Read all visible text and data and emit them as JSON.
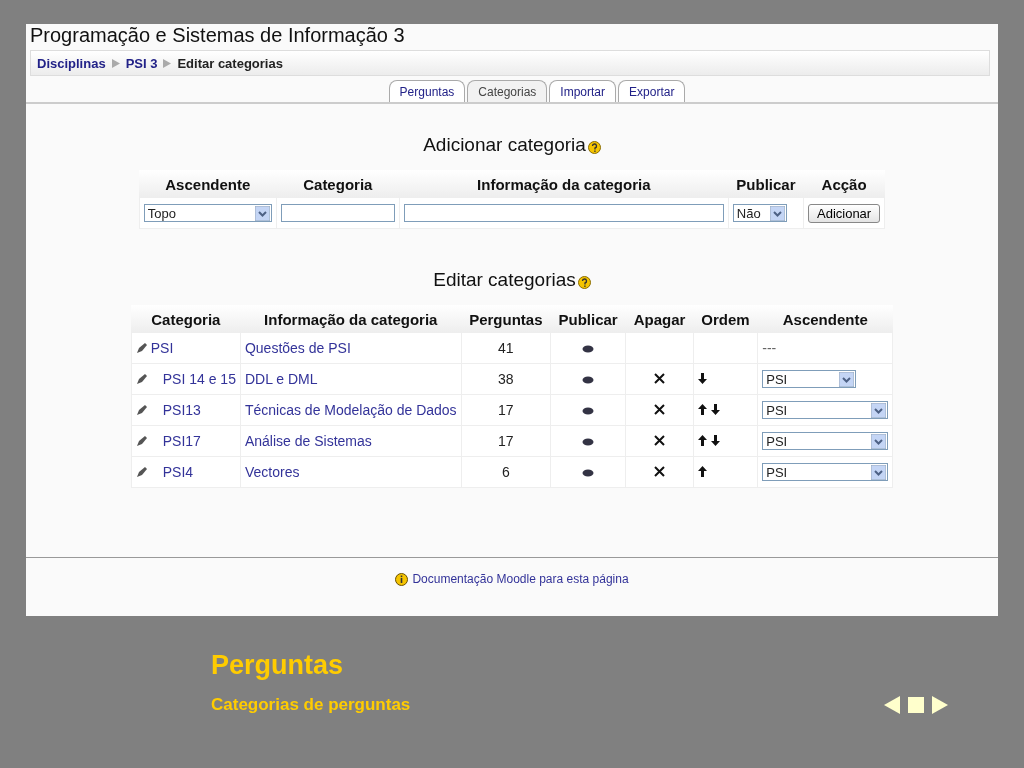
{
  "course_title": "Programação e Sistemas de Informação 3",
  "breadcrumb": [
    {
      "label": "Disciplinas",
      "kind": "link"
    },
    {
      "label": "PSI 3",
      "kind": "link"
    },
    {
      "label": "Editar categorias",
      "kind": "current"
    }
  ],
  "tabs": [
    {
      "label": "Perguntas",
      "selected": false
    },
    {
      "label": "Categorias",
      "selected": true
    },
    {
      "label": "Importar",
      "selected": false
    },
    {
      "label": "Exportar",
      "selected": false
    }
  ],
  "add_category": {
    "heading": "Adicionar categoria",
    "columns": [
      "Ascendente",
      "Categoria",
      "Informação da categoria",
      "Publicar",
      "Acção"
    ],
    "parent": "Topo",
    "publish": "Não",
    "button": "Adicionar"
  },
  "edit_categories": {
    "heading": "Editar categorias",
    "columns": [
      "Categoria",
      "Informação da categoria",
      "Perguntas",
      "Publicar",
      "Apagar",
      "Ordem",
      "Ascendente"
    ],
    "rows": [
      {
        "name": "PSI",
        "info": "Questões de PSI",
        "questions": "41",
        "deletable": false,
        "move_up": false,
        "move_down": false,
        "parent": {
          "kind": "text",
          "value": "---"
        },
        "children": [
          {
            "name": "PSI 14 e 15",
            "info": "DDL e DML",
            "questions": "38",
            "deletable": true,
            "move_up": false,
            "move_down": true,
            "parent": {
              "kind": "select",
              "value": "PSI",
              "wide": false
            }
          },
          {
            "name": "PSI13",
            "info": "Técnicas de Modelação de Dados",
            "questions": "17",
            "deletable": true,
            "move_up": true,
            "move_down": true,
            "parent": {
              "kind": "select",
              "value": "PSI",
              "wide": true
            }
          },
          {
            "name": "PSI17",
            "info": "Análise de Sistemas",
            "questions": "17",
            "deletable": true,
            "move_up": true,
            "move_down": true,
            "parent": {
              "kind": "select",
              "value": "PSI",
              "wide": true
            }
          },
          {
            "name": "PSI4",
            "info": "Vectores",
            "questions": "6",
            "deletable": true,
            "move_up": true,
            "move_down": false,
            "parent": {
              "kind": "select",
              "value": "PSI",
              "wide": true
            }
          }
        ]
      }
    ]
  },
  "footer": {
    "doc_link": "Documentação Moodle para esta página"
  },
  "slide": {
    "title": "Perguntas",
    "subtitle": "Categorias de perguntas"
  }
}
